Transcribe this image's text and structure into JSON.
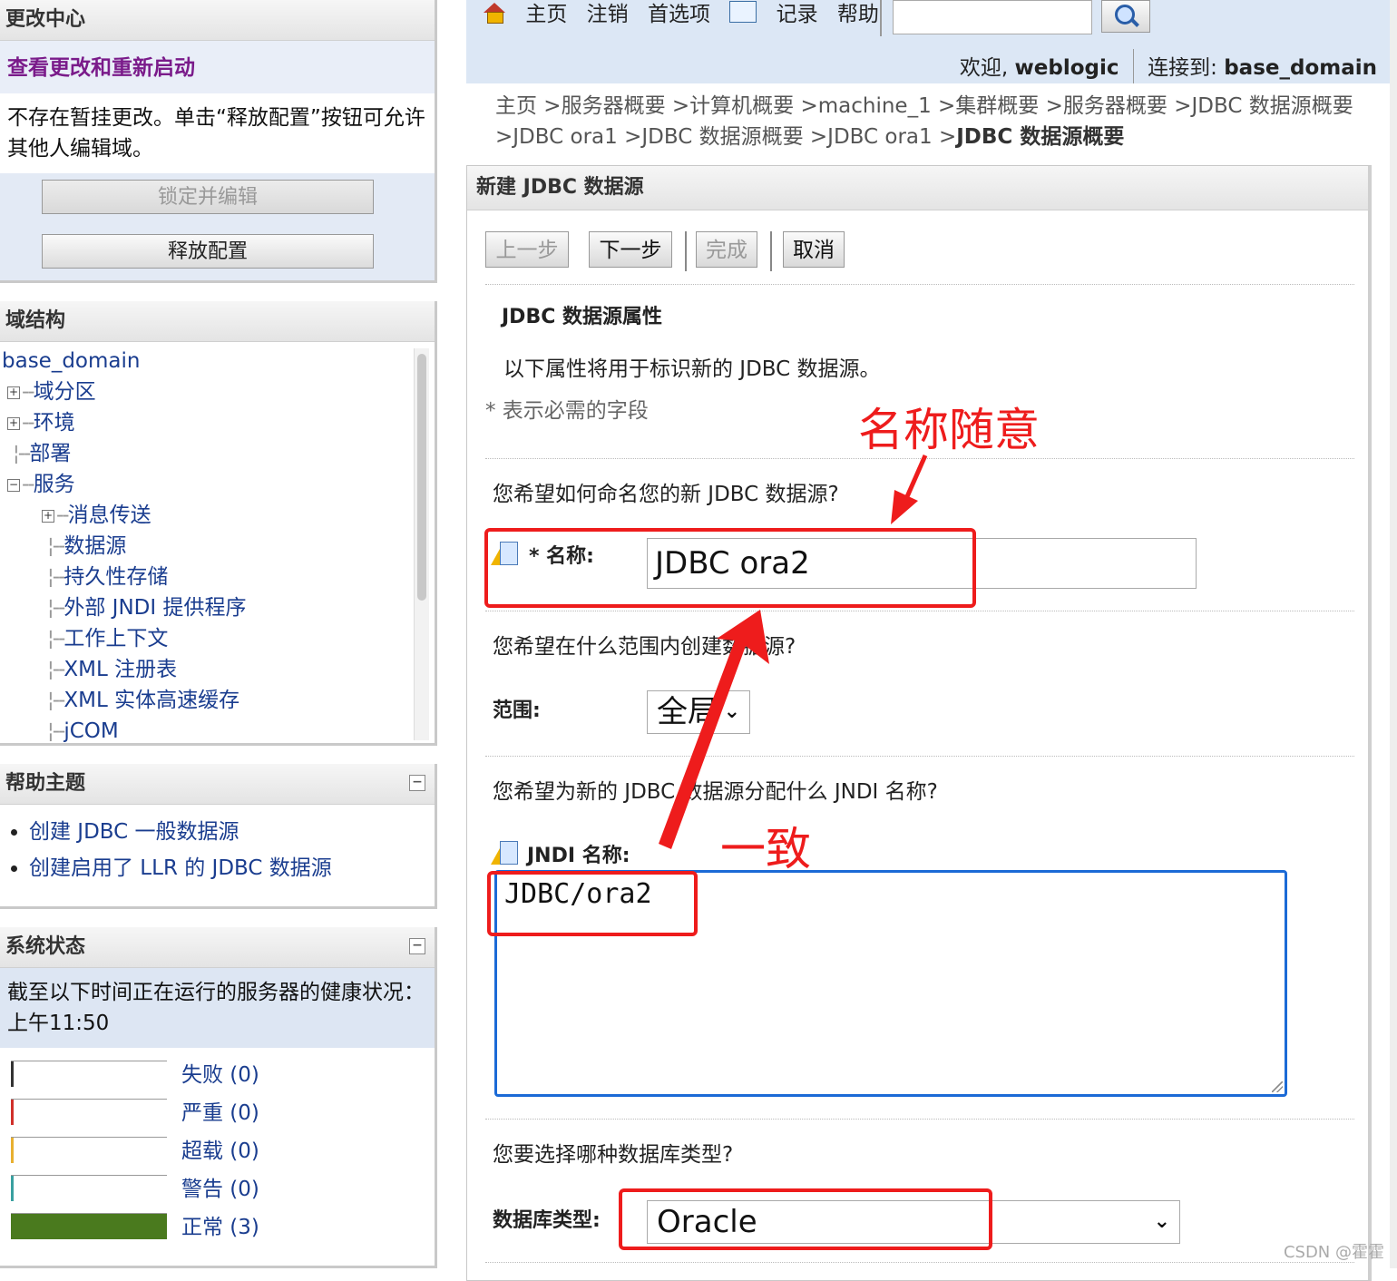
{
  "change_center": {
    "title": "更改中心",
    "link": "查看更改和重新启动",
    "message": "不存在暂挂更改。单击“释放配置”按钮可允许其他人编辑域。",
    "lock_button": "锁定并编辑",
    "release_button": "释放配置"
  },
  "domain_structure": {
    "title": "域结构",
    "root": "base_domain",
    "items": [
      {
        "label": "域分区",
        "expander": "+"
      },
      {
        "label": "环境",
        "expander": "+"
      },
      {
        "label": "部署",
        "expander": ""
      },
      {
        "label": "服务",
        "expander": "−"
      },
      {
        "label": "消息传送",
        "expander": "+"
      },
      {
        "label": "数据源",
        "expander": ""
      },
      {
        "label": "持久性存储",
        "expander": ""
      },
      {
        "label": "外部 JNDI 提供程序",
        "expander": ""
      },
      {
        "label": "工作上下文",
        "expander": ""
      },
      {
        "label": "XML 注册表",
        "expander": ""
      },
      {
        "label": "XML 实体高速缓存",
        "expander": ""
      },
      {
        "label": "jCOM",
        "expander": ""
      }
    ]
  },
  "help_topics": {
    "title": "帮助主题",
    "collapse": "−",
    "items": [
      "创建 JDBC 一般数据源",
      "创建启用了 LLR 的 JDBC 数据源"
    ]
  },
  "system_status": {
    "title": "系统状态",
    "collapse": "−",
    "message": "截至以下时间正在运行的服务器的健康状况：上午11:50",
    "rows": [
      {
        "label": "失败 (0)",
        "color": "#333333",
        "fill": 0
      },
      {
        "label": "严重 (0)",
        "color": "#d0302a",
        "fill": 0
      },
      {
        "label": "超载 (0)",
        "color": "#e8b030",
        "fill": 0
      },
      {
        "label": "警告 (0)",
        "color": "#3aa0a0",
        "fill": 0
      },
      {
        "label": "正常 (3)",
        "color": "#4a7a1e",
        "fill": 1
      }
    ]
  },
  "top_nav": {
    "home": "主页",
    "logout": "注销",
    "preferences": "首选项",
    "record": "记录",
    "help": "帮助",
    "search_value": "",
    "welcome_prefix": "欢迎,",
    "welcome_user": "weblogic",
    "connected_prefix": "连接到:",
    "connected_domain": "base_domain"
  },
  "breadcrumb": {
    "path": "主页 >服务器概要 >计算机概要 >machine_1 >集群概要 >服务器概要 >JDBC 数据源概要 >JDBC ora1 >JDBC 数据源概要 >JDBC ora1 >",
    "current": "JDBC 数据源概要"
  },
  "wizard": {
    "title": "新建 JDBC 数据源",
    "buttons": {
      "back": "上一步",
      "next": "下一步",
      "finish": "完成",
      "cancel": "取消"
    },
    "section_title": "JDBC 数据源属性",
    "intro": "以下属性将用于标识新的 JDBC 数据源。",
    "required_note": "* 表示必需的字段",
    "q_name": "您希望如何命名您的新 JDBC 数据源?",
    "name_label": "* 名称:",
    "name_value": "JDBC ora2",
    "q_scope": "您希望在什么范围内创建数据源?",
    "scope_label": "范围:",
    "scope_value": "全局",
    "q_jndi": "您希望为新的 JDBC 数据源分配什么 JNDI 名称?",
    "jndi_label": "JNDI 名称:",
    "jndi_value": "JDBC/ora2",
    "q_dbtype": "您要选择哪种数据库类型?",
    "dbtype_label": "数据库类型:",
    "dbtype_value": "Oracle"
  },
  "annotations": {
    "name_note": "名称随意",
    "consistent_note": "一致",
    "color": "#ee1c1c"
  },
  "watermark": "CSDN @霍霍"
}
